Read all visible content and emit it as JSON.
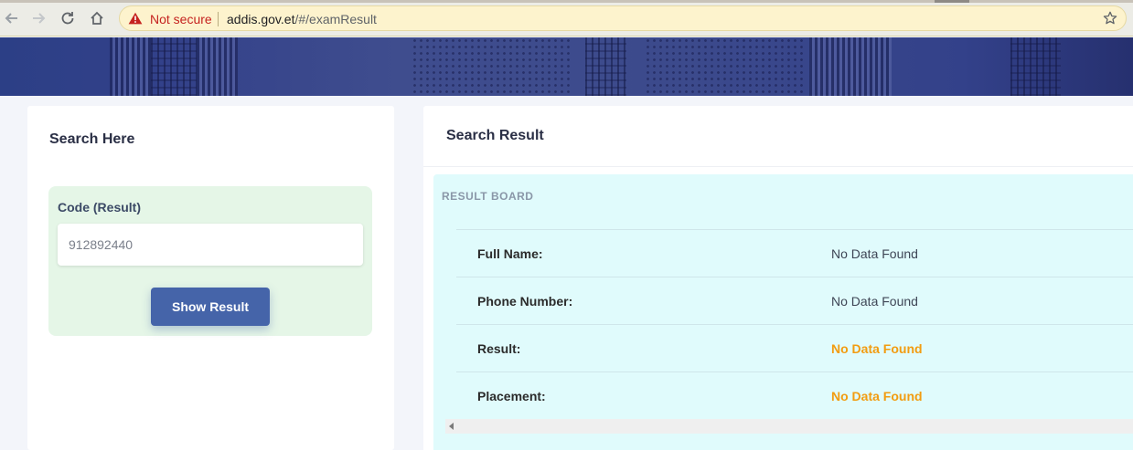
{
  "browser": {
    "security_label": "Not secure",
    "url_host": "addis.gov.et",
    "url_path": "/#/examResult",
    "icons": [
      "back-arrow-icon",
      "forward-arrow-icon",
      "reload-icon",
      "home-icon",
      "warning-icon",
      "star-icon"
    ]
  },
  "search_panel": {
    "title": "Search Here",
    "code_label": "Code (Result)",
    "code_value": "912892440",
    "button_label": "Show Result"
  },
  "result_panel": {
    "title": "Search Result",
    "board_title": "RESULT BOARD",
    "rows": [
      {
        "label": "Full Name:",
        "value": "No Data Found",
        "highlight": false
      },
      {
        "label": "Phone Number:",
        "value": "No Data Found",
        "highlight": false
      },
      {
        "label": "Result:",
        "value": "No Data Found",
        "highlight": true
      },
      {
        "label": "Placement:",
        "value": "No Data Found",
        "highlight": true
      }
    ]
  },
  "colors": {
    "primary_button": "#4564a9",
    "search_box_bg": "#e5f6e7",
    "result_board_bg": "#e0fbfc",
    "warning_value": "#f29c11",
    "not_secure": "#c5221f"
  }
}
